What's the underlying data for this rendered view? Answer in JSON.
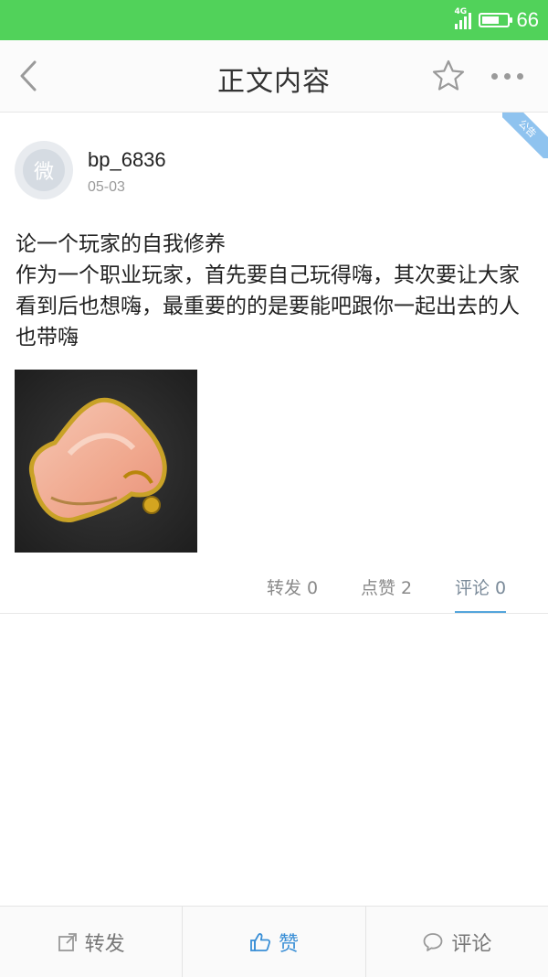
{
  "status_bar": {
    "network_label": "4G",
    "battery_level": "66",
    "color": "#51d25a"
  },
  "nav": {
    "title": "正文内容",
    "icons": [
      "back-arrow-icon",
      "star-icon",
      "more-icon"
    ]
  },
  "ribbon": {
    "label": "公告"
  },
  "post": {
    "avatar_glyph": "微",
    "username": "bp_6836",
    "date": "05-03",
    "lines": [
      "论一个玩家的自我修养",
      "作为一个职业玩家，首先要自己玩得嗨，其次要让大家看到后也想嗨，最重要的的是要能吧跟你一起出去的人也带嗨"
    ]
  },
  "stats": {
    "repost": "转发 0",
    "like": "点赞 2",
    "comment": "评论 0",
    "active": "comment",
    "accent_color": "#54a5db"
  },
  "bottom_bar": {
    "repost": "转发",
    "like": "赞",
    "comment": "评论",
    "like_color": "#3a8fd6"
  }
}
